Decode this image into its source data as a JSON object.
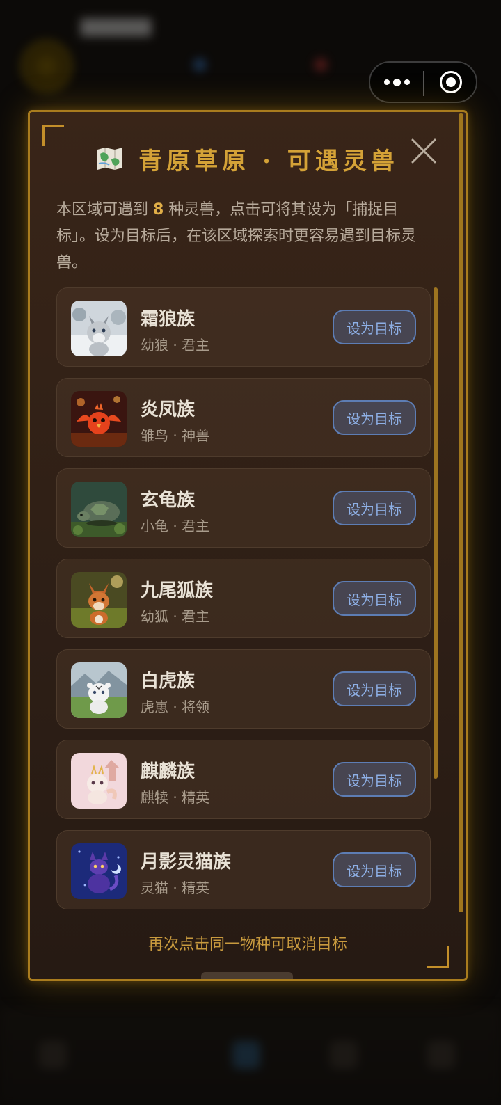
{
  "background": {
    "player_name": "██████"
  },
  "modal": {
    "title": "青原草原 · 可遇灵兽",
    "title_icon": "map-icon",
    "close_icon": "close-icon",
    "description_before": "本区域可遇到 ",
    "count": "8",
    "description_after": " 种灵兽，点击可将其设为「捕捉目标」。设为目标后，在该区域探索时更容易遇到目标灵兽。",
    "footer": "再次点击同一物种可取消目标",
    "accent_color": "#d4a237",
    "button_color": "#8eb0e6"
  },
  "beasts": [
    {
      "name": "霜狼族",
      "sub": "幼狼 · 君主",
      "button": "设为目标",
      "icon": "frost-wolf-thumb"
    },
    {
      "name": "炎凤族",
      "sub": "雏鸟 · 神兽",
      "button": "设为目标",
      "icon": "flame-phoenix-thumb"
    },
    {
      "name": "玄龟族",
      "sub": "小龟 · 君主",
      "button": "设为目标",
      "icon": "black-turtle-thumb"
    },
    {
      "name": "九尾狐族",
      "sub": "幼狐 · 君主",
      "button": "设为目标",
      "icon": "nine-tail-fox-thumb"
    },
    {
      "name": "白虎族",
      "sub": "虎崽 · 将领",
      "button": "设为目标",
      "icon": "white-tiger-thumb"
    },
    {
      "name": "麒麟族",
      "sub": "麒犊 · 精英",
      "button": "设为目标",
      "icon": "qilin-thumb"
    },
    {
      "name": "月影灵猫族",
      "sub": "灵猫 · 精英",
      "button": "设为目标",
      "icon": "moon-cat-thumb"
    }
  ]
}
